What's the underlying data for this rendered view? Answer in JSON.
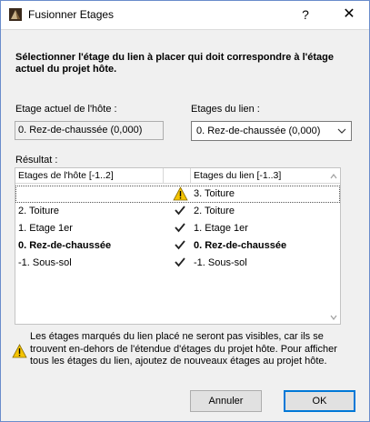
{
  "window": {
    "title": "Fusionner Etages",
    "help_label": "?",
    "close_label": "✕"
  },
  "instruction": "Sélectionner l'étage du lien à placer qui doit correspondre à l'étage actuel du projet hôte.",
  "host_story": {
    "label": "Etage actuel de l'hôte :",
    "value": "0. Rez-de-chaussée (0,000)"
  },
  "link_story": {
    "label": "Etages du lien :",
    "selected": "0. Rez-de-chaussée (0,000)"
  },
  "result": {
    "label": "Résultat :",
    "columns": {
      "host": "Etages de l'hôte [-1..2]",
      "link": "Etages du lien [-1..3]"
    },
    "rows": [
      {
        "host": "",
        "status": "warning",
        "link": "3. Toiture",
        "bold": false
      },
      {
        "host": "2. Toiture",
        "status": "check",
        "link": "2. Toiture",
        "bold": false
      },
      {
        "host": "1. Etage 1er",
        "status": "check",
        "link": "1. Etage 1er",
        "bold": false
      },
      {
        "host": "0. Rez-de-chaussée",
        "status": "check",
        "link": "0. Rez-de-chaussée",
        "bold": true
      },
      {
        "host": "-1. Sous-sol",
        "status": "check",
        "link": "-1. Sous-sol",
        "bold": false
      }
    ]
  },
  "warning_text": "Les étages marqués du lien placé ne seront pas visibles, car ils se trouvent en-dehors de l'étendue d'étages du projet hôte. Pour afficher tous les étages du lien, ajoutez de nouveaux étages au projet hôte.",
  "buttons": {
    "cancel": "Annuler",
    "ok": "OK"
  },
  "colors": {
    "warning_fill": "#f5c400",
    "accent": "#0078d7"
  }
}
